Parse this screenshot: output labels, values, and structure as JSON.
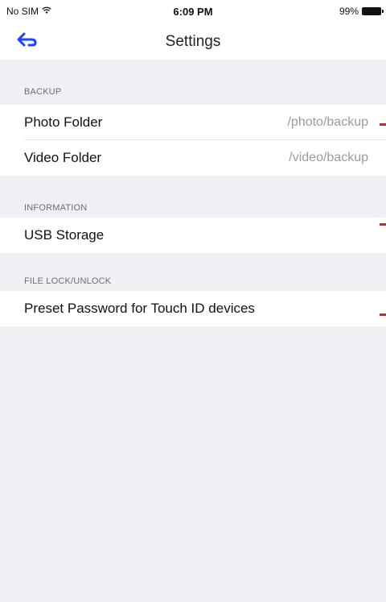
{
  "status_bar": {
    "carrier": "No SIM",
    "time": "6:09 PM",
    "battery": "99%"
  },
  "nav": {
    "title": "Settings",
    "back_icon": "back-arrow-icon",
    "accent": "#1a44ff"
  },
  "sections": [
    {
      "header": "BACKUP",
      "rows": [
        {
          "label": "Photo Folder",
          "value": "/photo/backup"
        },
        {
          "label": "Video Folder",
          "value": "/video/backup"
        }
      ]
    },
    {
      "header": "INFORMATION",
      "rows": [
        {
          "label": "USB Storage",
          "value": ""
        }
      ]
    },
    {
      "header": "FILE LOCK/UNLOCK",
      "rows": [
        {
          "label": "Preset Password for Touch ID devices",
          "value": ""
        }
      ]
    }
  ],
  "colors": {
    "marker": "#e02020",
    "background": "#efeff4"
  }
}
